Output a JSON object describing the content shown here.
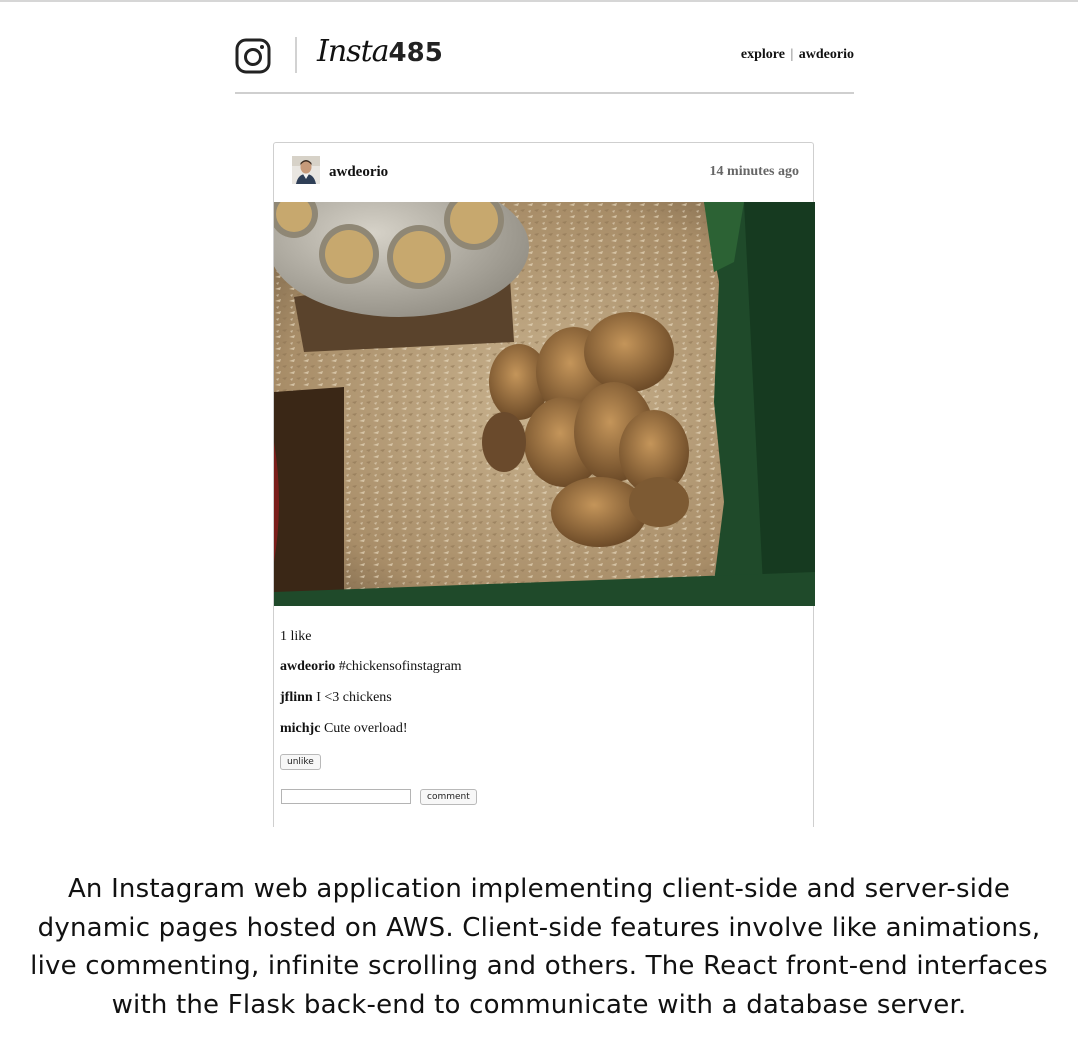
{
  "app": {
    "brand_script": "Insta",
    "brand_number": "485"
  },
  "nav": {
    "explore": "explore",
    "separator": "|",
    "user": "awdeorio"
  },
  "post": {
    "owner": "awdeorio",
    "timestamp": "14 minutes ago",
    "likes_text": "1 like",
    "comments": [
      {
        "owner": "awdeorio",
        "text": "#chickensofinstagram"
      },
      {
        "owner": "jflinn",
        "text": "I <3 chickens"
      },
      {
        "owner": "michjc",
        "text": "Cute overload!"
      }
    ],
    "unlike_label": "unlike",
    "comment_value": "",
    "comment_label": "comment"
  },
  "caption": "An Instagram web application implementing client-side and server-side dynamic pages hosted on AWS. Client-side features involve like animations, live commenting, infinite scrolling and others. The React front-end interfaces with the Flask back-end to communicate with a database server.",
  "colors": {
    "text": "#111111",
    "muted": "#666666",
    "rule": "#cfcfcf"
  },
  "icons": {
    "logo": "instagram-camera-icon"
  }
}
